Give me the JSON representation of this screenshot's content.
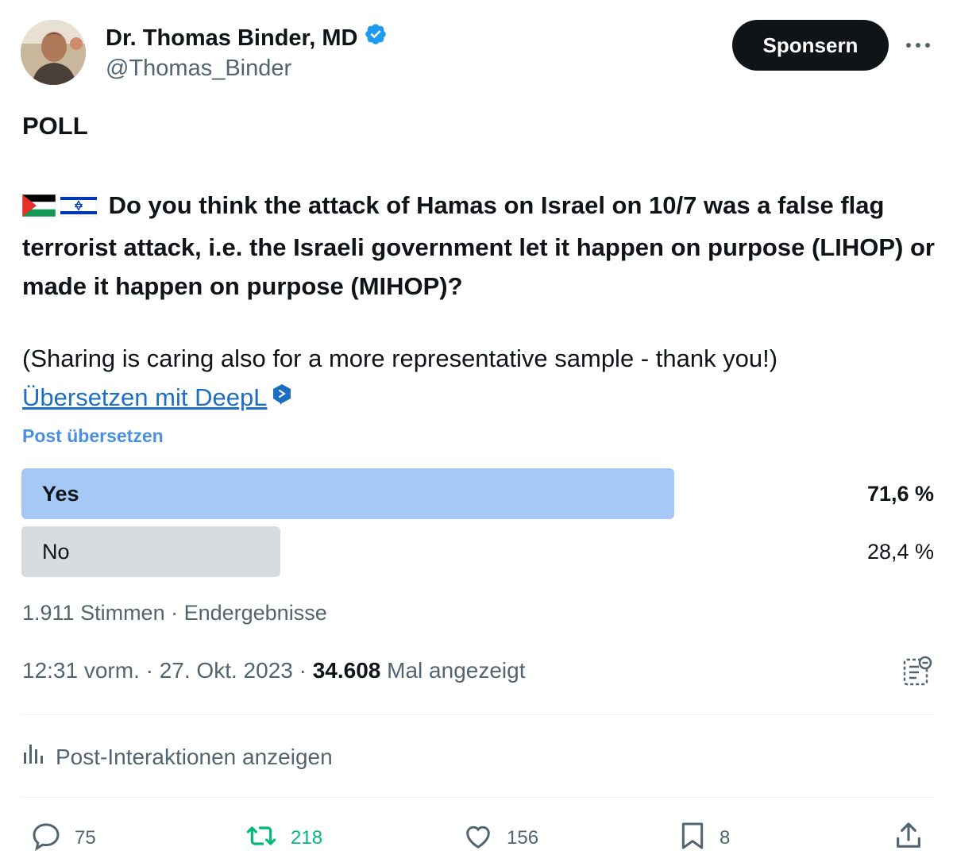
{
  "author": {
    "name": "Dr. Thomas Binder, MD",
    "handle": "@Thomas_Binder",
    "verified_color": "#1d9bf0"
  },
  "header": {
    "sponsor_label": "Sponsern"
  },
  "post": {
    "title": "POLL",
    "question": "Do you think the attack of Hamas on Israel on 10/7 was a false flag terrorist attack, i.e. the Israeli government let it happen on purpose (LIHOP) or made it happen on purpose (MIHOP)?",
    "flags": [
      "palestine-flag",
      "israel-flag"
    ],
    "sharing": "(Sharing is caring also for a more representative sample - thank you!)",
    "deepl_link": "Übersetzen mit DeepL",
    "translate_label": "Post übersetzen"
  },
  "poll": {
    "options": [
      {
        "label": "Yes",
        "percent_text": "71,6 %",
        "fraction": 0.716,
        "winner": true,
        "color": "#a6c8f5"
      },
      {
        "label": "No",
        "percent_text": "28,4 %",
        "fraction": 0.284,
        "winner": false,
        "color": "#d7dcdf"
      }
    ],
    "votes_text": "1.911 Stimmen · Endergebnisse"
  },
  "meta": {
    "time": "12:31 vorm. · 27. Okt. 2023 · ",
    "views": "34.608",
    "views_label": " Mal angezeigt"
  },
  "interactions_label": "Post-Interaktionen anzeigen",
  "actions": {
    "replies": "75",
    "retweets": "218",
    "likes": "156",
    "bookmarks": "8"
  }
}
